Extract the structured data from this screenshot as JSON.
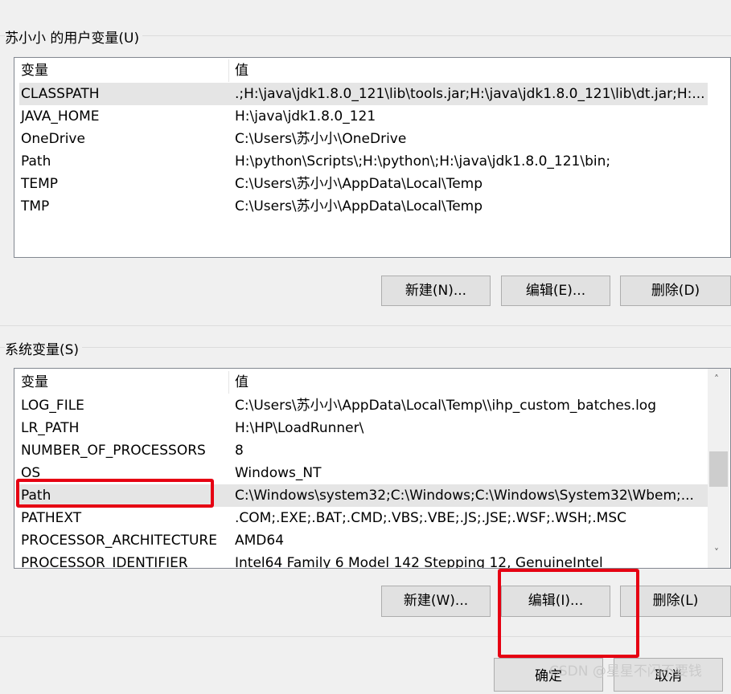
{
  "user_vars": {
    "title": "苏小小 的用户变量(U)",
    "header": {
      "name": "变量",
      "value": "值"
    },
    "rows": [
      {
        "name": "CLASSPATH",
        "value": ".;H:\\java\\jdk1.8.0_121\\lib\\tools.jar;H:\\java\\jdk1.8.0_121\\lib\\dt.jar;H:..."
      },
      {
        "name": "JAVA_HOME",
        "value": "H:\\java\\jdk1.8.0_121"
      },
      {
        "name": "OneDrive",
        "value": "C:\\Users\\苏小小\\OneDrive"
      },
      {
        "name": "Path",
        "value": "H:\\python\\Scripts\\;H:\\python\\;H:\\java\\jdk1.8.0_121\\bin;"
      },
      {
        "name": "TEMP",
        "value": "C:\\Users\\苏小小\\AppData\\Local\\Temp"
      },
      {
        "name": "TMP",
        "value": "C:\\Users\\苏小小\\AppData\\Local\\Temp"
      }
    ],
    "buttons": {
      "new": "新建(N)...",
      "edit": "编辑(E)...",
      "delete": "删除(D)"
    }
  },
  "system_vars": {
    "title": "系统变量(S)",
    "header": {
      "name": "变量",
      "value": "值"
    },
    "rows": [
      {
        "name": "LOG_FILE",
        "value": "C:\\Users\\苏小小\\AppData\\Local\\Temp\\\\ihp_custom_batches.log"
      },
      {
        "name": "LR_PATH",
        "value": "H:\\HP\\LoadRunner\\"
      },
      {
        "name": "NUMBER_OF_PROCESSORS",
        "value": "8"
      },
      {
        "name": "OS",
        "value": "Windows_NT"
      },
      {
        "name": "Path",
        "value": "C:\\Windows\\system32;C:\\Windows;C:\\Windows\\System32\\Wbem;..."
      },
      {
        "name": "PATHEXT",
        "value": ".COM;.EXE;.BAT;.CMD;.VBS;.VBE;.JS;.JSE;.WSF;.WSH;.MSC"
      },
      {
        "name": "PROCESSOR_ARCHITECTURE",
        "value": "AMD64"
      },
      {
        "name": "PROCESSOR_IDENTIFIER",
        "value": "Intel64 Family 6 Model 142 Stepping 12, GenuineIntel"
      }
    ],
    "buttons": {
      "new": "新建(W)...",
      "edit": "编辑(I)...",
      "delete": "删除(L)"
    }
  },
  "dialog": {
    "ok": "确定",
    "cancel": "取消"
  },
  "watermark": "CSDN @星星不闪不要钱",
  "colors": {
    "highlight": "#e60012"
  }
}
